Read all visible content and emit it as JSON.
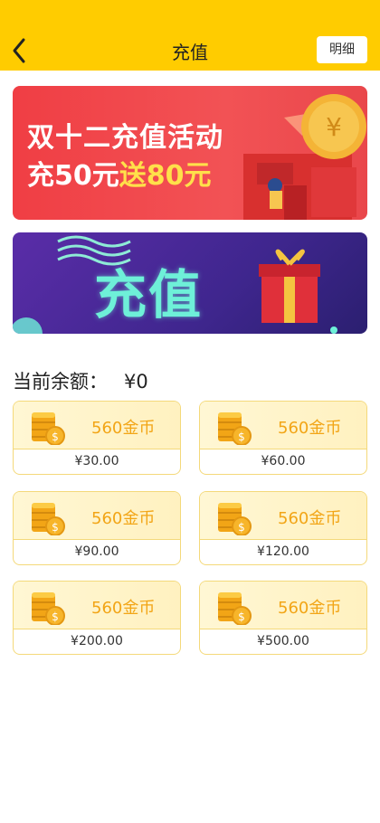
{
  "header": {
    "title": "充值",
    "detail_button": "明细"
  },
  "banner1": {
    "line1": "双十二充值活动",
    "line2_prefix": "充50元",
    "line2_highlight": "送80元"
  },
  "banner2": {
    "text": "充值"
  },
  "balance": {
    "label": "当前余额：",
    "amount": "¥0"
  },
  "packages": [
    {
      "coins": "560金币",
      "price": "¥30.00"
    },
    {
      "coins": "560金币",
      "price": "¥60.00"
    },
    {
      "coins": "560金币",
      "price": "¥90.00"
    },
    {
      "coins": "560金币",
      "price": "¥120.00"
    },
    {
      "coins": "560金币",
      "price": "¥200.00"
    },
    {
      "coins": "560金币",
      "price": "¥500.00"
    }
  ],
  "colors": {
    "header": "#FFCC00",
    "coin_text": "#F2A516",
    "banner1": "#F03E44",
    "banner2": "#4A2A9A"
  }
}
